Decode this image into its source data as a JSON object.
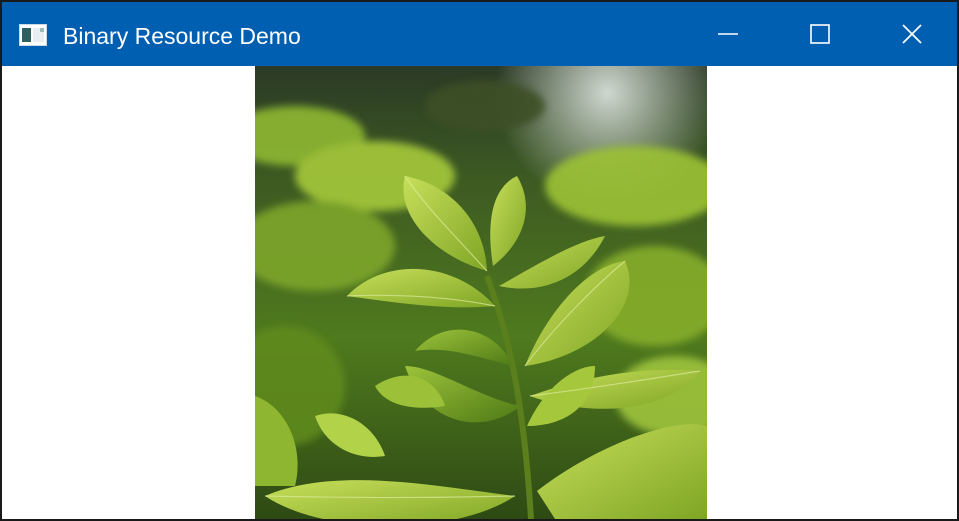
{
  "window": {
    "title": "Binary Resource Demo",
    "titlebar_color": "#005fb1",
    "icon": "window-app-icon",
    "controls": {
      "minimize_icon": "minimize-icon",
      "maximize_icon": "maximize-icon",
      "close_icon": "close-icon"
    }
  },
  "content": {
    "image": {
      "subject": "photo",
      "icon": "image"
    }
  }
}
